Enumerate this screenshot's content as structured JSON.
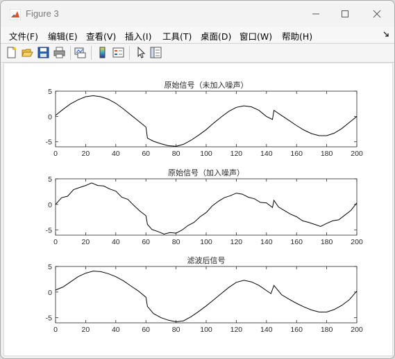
{
  "window": {
    "title": "Figure 3"
  },
  "menu": [
    "文件(F)",
    "编辑(E)",
    "查看(V)",
    "插入(I)",
    "工具(T)",
    "桌面(D)",
    "窗口(W)",
    "帮助(H)"
  ],
  "toolbar": [
    "new-figure",
    "open-file",
    "save",
    "print",
    "link-plot",
    "insert-colorbar",
    "insert-legend",
    "edit-plot",
    "property-inspector"
  ],
  "chart_data": [
    {
      "type": "line",
      "title": "原始信号（未加入噪声）",
      "xlim": [
        0,
        200
      ],
      "ylim": [
        -6,
        5
      ],
      "xticks": [
        "0",
        "20",
        "40",
        "60",
        "80",
        "100",
        "120",
        "140",
        "160",
        "180",
        "200"
      ],
      "yticks": [
        "5",
        "0",
        "-5"
      ],
      "x": [
        0,
        5,
        10,
        15,
        20,
        25,
        30,
        35,
        40,
        45,
        50,
        55,
        60,
        61,
        65,
        70,
        75,
        80,
        85,
        90,
        95,
        100,
        105,
        110,
        115,
        120,
        125,
        130,
        135,
        140,
        144,
        145,
        150,
        155,
        160,
        165,
        170,
        175,
        180,
        185,
        190,
        195,
        200
      ],
      "series": [
        {
          "values": [
            0.2,
            1.4,
            2.5,
            3.3,
            3.9,
            4.1,
            3.9,
            3.4,
            2.6,
            1.5,
            0.3,
            -0.9,
            -2.1,
            -4.3,
            -4.9,
            -5.4,
            -5.8,
            -5.9,
            -5.5,
            -4.7,
            -3.7,
            -2.6,
            -1.3,
            -0.1,
            1.0,
            1.8,
            2.1,
            1.9,
            1.2,
            0.0,
            -0.6,
            1.2,
            0.2,
            -0.8,
            -1.8,
            -2.7,
            -3.4,
            -3.8,
            -3.8,
            -3.3,
            -2.4,
            -1.2,
            0.0
          ]
        }
      ]
    },
    {
      "type": "line",
      "title": "原始信号（加入噪声）",
      "xlim": [
        0,
        200
      ],
      "ylim": [
        -6,
        5
      ],
      "xticks": [
        "0",
        "20",
        "40",
        "60",
        "80",
        "100",
        "120",
        "140",
        "160",
        "180",
        "200"
      ],
      "yticks": [
        "5",
        "0",
        "-5"
      ],
      "x": [
        0,
        4,
        8,
        12,
        16,
        20,
        24,
        28,
        32,
        36,
        40,
        44,
        48,
        52,
        56,
        60,
        61,
        64,
        68,
        72,
        76,
        80,
        84,
        88,
        92,
        96,
        100,
        104,
        108,
        112,
        116,
        120,
        124,
        128,
        132,
        136,
        140,
        144,
        145,
        148,
        152,
        156,
        160,
        164,
        168,
        172,
        176,
        180,
        184,
        188,
        192,
        196,
        200
      ],
      "series": [
        {
          "values": [
            0.0,
            1.3,
            1.6,
            2.9,
            3.3,
            3.7,
            4.2,
            3.7,
            3.6,
            3.0,
            2.6,
            1.4,
            1.0,
            -0.2,
            -1.3,
            -2.2,
            -3.9,
            -4.9,
            -5.3,
            -5.8,
            -5.5,
            -5.6,
            -5.0,
            -4.1,
            -3.5,
            -2.4,
            -1.6,
            -0.3,
            0.6,
            1.3,
            1.7,
            2.2,
            2.0,
            1.4,
            1.1,
            0.4,
            0.3,
            -0.6,
            0.8,
            -0.5,
            -1.2,
            -1.9,
            -2.4,
            -3.2,
            -3.5,
            -3.9,
            -4.3,
            -3.7,
            -3.2,
            -3.0,
            -2.1,
            -1.2,
            0.3
          ]
        }
      ]
    },
    {
      "type": "line",
      "title": "滤波后信号",
      "xlim": [
        0,
        200
      ],
      "ylim": [
        -6,
        5
      ],
      "xticks": [
        "0",
        "20",
        "40",
        "60",
        "80",
        "100",
        "120",
        "140",
        "160",
        "180",
        "200"
      ],
      "yticks": [
        "5",
        "0",
        "-5"
      ],
      "x": [
        0,
        5,
        10,
        15,
        20,
        25,
        30,
        35,
        40,
        45,
        50,
        55,
        60,
        61,
        65,
        70,
        75,
        80,
        85,
        90,
        95,
        100,
        105,
        110,
        115,
        120,
        125,
        130,
        135,
        140,
        143,
        145,
        150,
        155,
        160,
        165,
        170,
        175,
        180,
        185,
        190,
        195,
        200
      ],
      "series": [
        {
          "values": [
            0.4,
            1.0,
            2.0,
            3.0,
            3.7,
            4.1,
            4.0,
            3.6,
            3.0,
            2.2,
            1.2,
            0.2,
            -1.0,
            -2.8,
            -4.2,
            -5.0,
            -5.5,
            -5.8,
            -5.6,
            -4.8,
            -3.8,
            -2.7,
            -1.5,
            -0.3,
            0.9,
            1.9,
            2.3,
            2.0,
            1.3,
            0.3,
            -0.3,
            1.3,
            -0.5,
            -1.4,
            -2.2,
            -2.9,
            -3.5,
            -3.9,
            -3.9,
            -3.4,
            -2.6,
            -1.5,
            0.2
          ]
        }
      ]
    }
  ]
}
